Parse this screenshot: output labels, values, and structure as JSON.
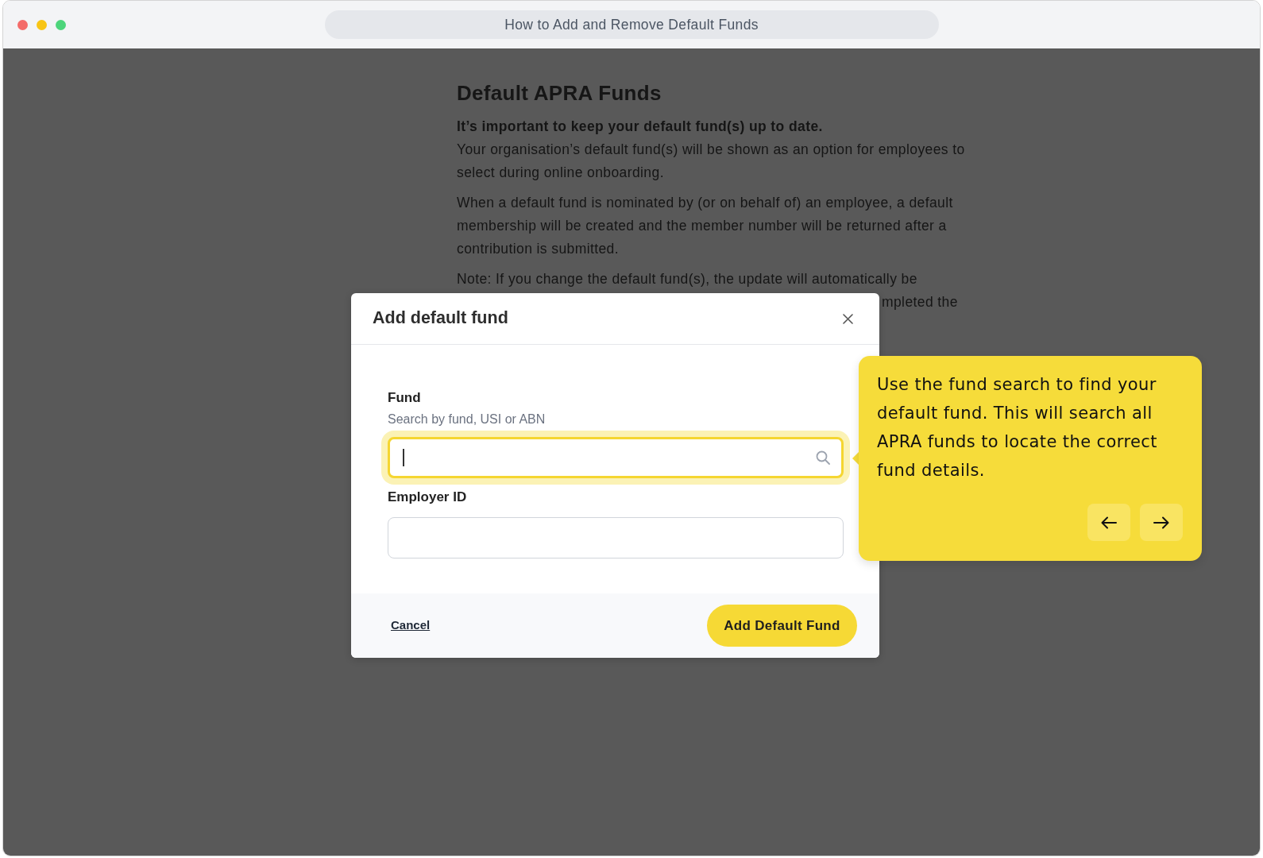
{
  "window": {
    "title": "How to Add and Remove Default Funds"
  },
  "article": {
    "heading": "Default APRA Funds",
    "lead": "It’s important to keep your default fund(s) up to date.",
    "paragraphs": [
      "Your organisation’s default fund(s) will be shown as an option for employees to select during online onboarding.",
      "When a default fund is nominated by (or on behalf of) an employee, a default membership will be created and the member number will be returned after a contribution is submitted."
    ],
    "note": "Note: If you change the default fund(s), the update will automatically be",
    "note_fragment": "mpleted the"
  },
  "modal": {
    "title": "Add default fund",
    "fields": [
      {
        "kind": "search",
        "label": "Fund",
        "help_text": "Search by fund, USI or ABN",
        "focused": true
      },
      {
        "kind": "text",
        "label": "Employer ID",
        "focused": false
      }
    ],
    "cancel": "Cancel",
    "submit": "Add Default Fund"
  },
  "tooltip": {
    "text": "Use the fund search to find your default fund. This will search all APRA funds to locate the correct fund details."
  }
}
